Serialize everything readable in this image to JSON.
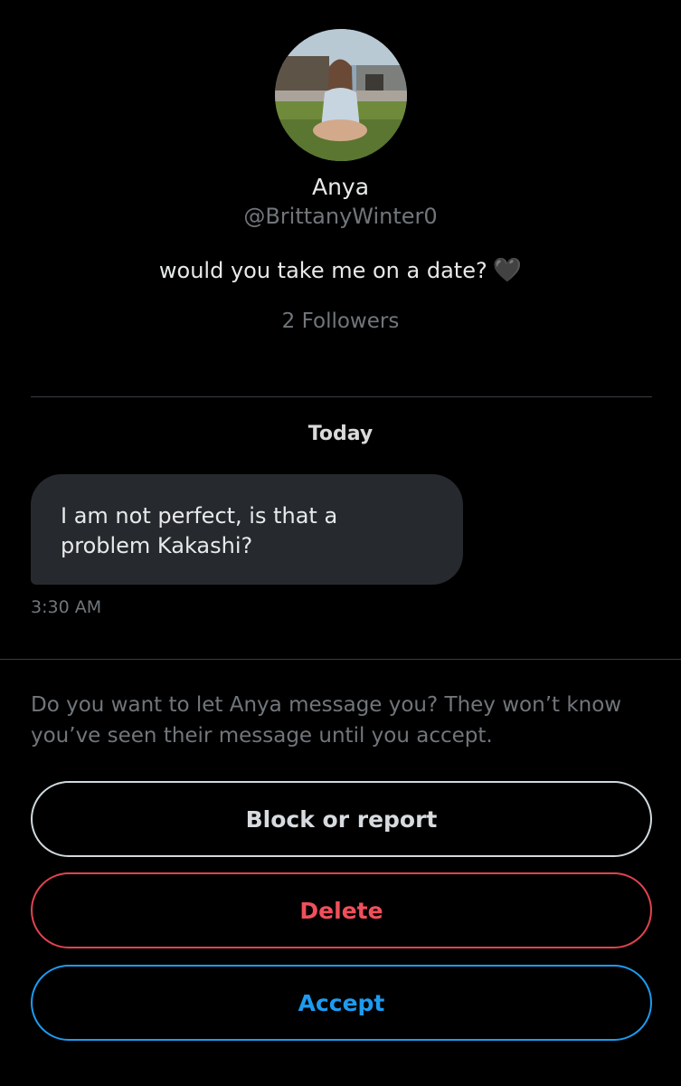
{
  "profile": {
    "name": "Anya",
    "handle": "@BrittanyWinter0",
    "bio": "would you take me on a date?",
    "bio_emoji": "🖤",
    "followers": "2 Followers"
  },
  "conversation": {
    "date_separator": "Today",
    "messages": [
      {
        "text": "I am not perfect, is that a problem Kakashi?",
        "time": "3:30 AM"
      }
    ]
  },
  "request": {
    "prompt": "Do you want to let Anya message you? They won’t know you’ve seen their message until you accept.",
    "block_label": "Block or report",
    "delete_label": "Delete",
    "accept_label": "Accept"
  },
  "colors": {
    "background": "#000000",
    "bubble": "#262a2e",
    "muted_text": "#71767b",
    "danger": "#f4212e",
    "accent": "#1d9bf0"
  }
}
